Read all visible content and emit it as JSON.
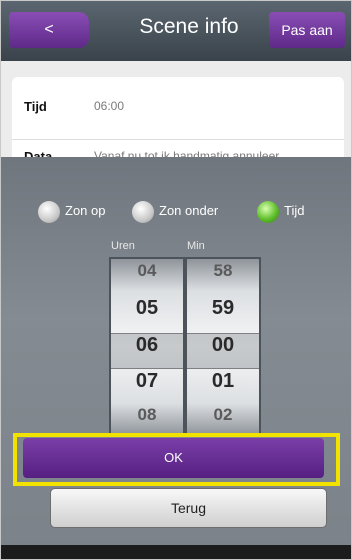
{
  "header": {
    "back_label": "<",
    "title": "Scene info",
    "edit_label": "Pas aan"
  },
  "info": {
    "rows": [
      {
        "label": "Tijd",
        "value": "06:00"
      },
      {
        "label": "Data",
        "value": "Vanaf nu tot ik handmatig annuleer"
      }
    ]
  },
  "picker": {
    "options": [
      {
        "label": "Zon op",
        "selected": false
      },
      {
        "label": "Zon onder",
        "selected": false
      },
      {
        "label": "Tijd",
        "selected": true
      }
    ],
    "hours_label": "Uren",
    "minutes_label": "Min",
    "hours": [
      "04",
      "05",
      "06",
      "07",
      "08"
    ],
    "minutes": [
      "58",
      "59",
      "00",
      "01",
      "02"
    ],
    "selected_hour": "06",
    "selected_minute": "00"
  },
  "buttons": {
    "ok": "OK",
    "back": "Terug"
  },
  "colors": {
    "accent": "#6a2f96",
    "highlight": "#f2e200",
    "radio_on": "#5fbf2b"
  }
}
